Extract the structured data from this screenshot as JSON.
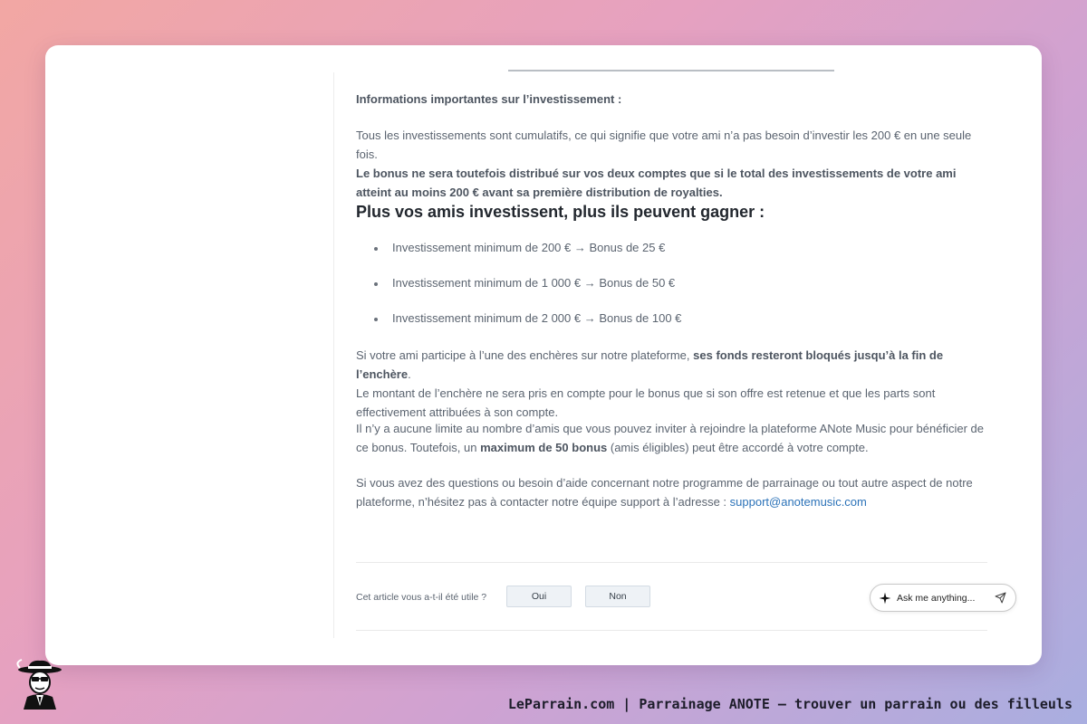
{
  "article": {
    "info_heading": "Informations importantes sur l’investissement :",
    "p1_text": "Tous les investissements sont cumulatifs, ce qui signifie que votre ami n’a pas besoin d’investir les 200 € en une seule fois.",
    "p1_bold": "Le bonus ne sera toutefois distribué sur vos deux comptes que si le total des investissements de votre ami atteint au moins 200 € avant sa première distribution de royalties.",
    "heading": "Plus vos amis investissent, plus ils peuvent gagner :",
    "bullets": [
      "Investissement minimum de 200 € → Bonus de 25 €",
      "Investissement minimum de 1 000 € → Bonus de 50 €",
      "Investissement minimum de 2 000 € → Bonus de 100 €"
    ],
    "p2_a": "Si votre ami participe à l’une des enchères sur notre plateforme,",
    "p2_bold": "ses fonds resteront bloqués jusqu’à la fin de l’enchère",
    "p2_b": ".",
    "p2_c": "Le montant de l’enchère ne sera pris en compte pour le bonus que si son offre est retenue et que les parts sont effectivement attribuées à son compte.",
    "p3_a": "Il n’y a aucune limite au nombre d’amis que vous pouvez inviter à rejoindre la plateforme ANote Music pour bénéficier de ce bonus. Toutefois, un",
    "p3_bold": "maximum de 50 bonus",
    "p3_b": "(amis éligibles) peut être accordé à votre compte.",
    "p4_a": "Si vous avez des questions ou besoin d’aide concernant notre programme de parrainage ou tout autre aspect de notre plateforme, n’hésitez pas à contacter notre équipe support à l’adresse :",
    "p4_link": "support@anotemusic.com"
  },
  "feedback": {
    "question": "Cet article vous a-t-il été utile ?",
    "yes": "Oui",
    "no": "Non"
  },
  "assistant": {
    "label": "Ask me anything..."
  },
  "footer": {
    "text": "LeParrain.com | Parrainage ANOTE — trouver un parrain ou des filleuls"
  },
  "icons": {
    "assistant": "sparkle-icon",
    "send": "send-icon",
    "logo": "leparrain-logo"
  }
}
